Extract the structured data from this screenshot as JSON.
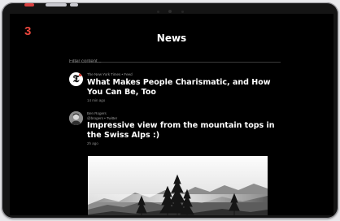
{
  "step_badge": "3",
  "header": {
    "title": "News"
  },
  "filter": {
    "placeholder": "Filter content..."
  },
  "feed": [
    {
      "avatar_icon": "new-york-times-logo",
      "source": "The New York Times • Feed",
      "headline": "What Makes People Charismatic, and How You Can Be, Too",
      "time": "14 min ago"
    },
    {
      "avatar_icon": "user-photo",
      "author": "Ben Rogers",
      "source": "@brogers • Twitter",
      "headline": "Impressive view from the mountain tops in the Swiss Alps :)",
      "time": "2h ago",
      "media_icon": "misty-mountain-forest-photo"
    }
  ],
  "colors": {
    "background": "#000000",
    "text": "#ffffff",
    "muted": "#9a9a9a",
    "badge": "#e8463c"
  }
}
